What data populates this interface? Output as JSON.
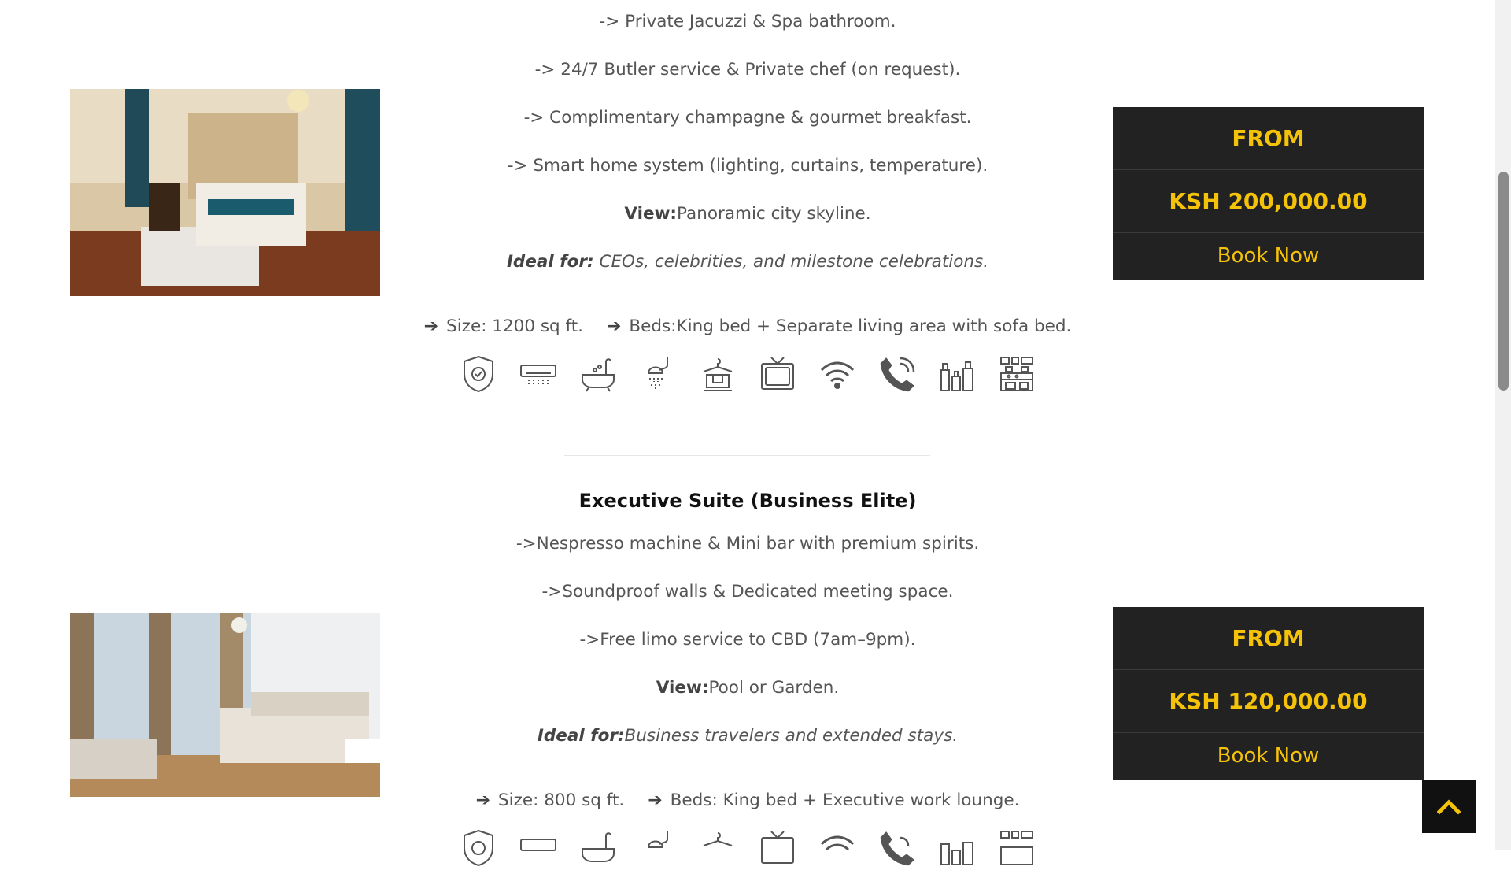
{
  "rooms": [
    {
      "lines": [
        "-> Private Jacuzzi & Spa bathroom.",
        "-> 24/7 Butler service & Private chef (on request).",
        "-> Complimentary champagne & gourmet breakfast.",
        "-> Smart home system (lighting, curtains, temperature)."
      ],
      "view_label": "View:",
      "view_value": "Panoramic city skyline.",
      "ideal_label": "Ideal for:",
      "ideal_value": " CEOs, celebrities, and milestone celebrations.",
      "size": "Size: 1200 sq ft.",
      "beds": "Beds:King bed + Separate living area with sofa bed.",
      "price_from": "FROM",
      "price": "KSH 200,000.00",
      "book": "Book Now"
    },
    {
      "title": "Executive Suite (Business Elite)",
      "lines": [
        "->Nespresso machine & Mini bar with premium spirits.",
        "->Soundproof walls & Dedicated meeting space.",
        "->Free limo service to CBD (7am–9pm)."
      ],
      "view_label": "View:",
      "view_value": "Pool or Garden.",
      "ideal_label": "Ideal for:",
      "ideal_value": "Business travelers and extended stays.",
      "size": "Size: 800 sq ft.",
      "beds": "Beds: King bed + Executive work lounge.",
      "price_from": "FROM",
      "price": "KSH 120,000.00",
      "book": "Book Now"
    }
  ],
  "amenity_icons": [
    "safe-icon",
    "air-conditioner-icon",
    "bathtub-icon",
    "shower-icon",
    "iron-icon",
    "tv-icon",
    "wifi-icon",
    "phone-icon",
    "toiletries-icon",
    "kitchen-icon"
  ],
  "colors": {
    "accent": "#f5c20a",
    "box": "#222222"
  }
}
